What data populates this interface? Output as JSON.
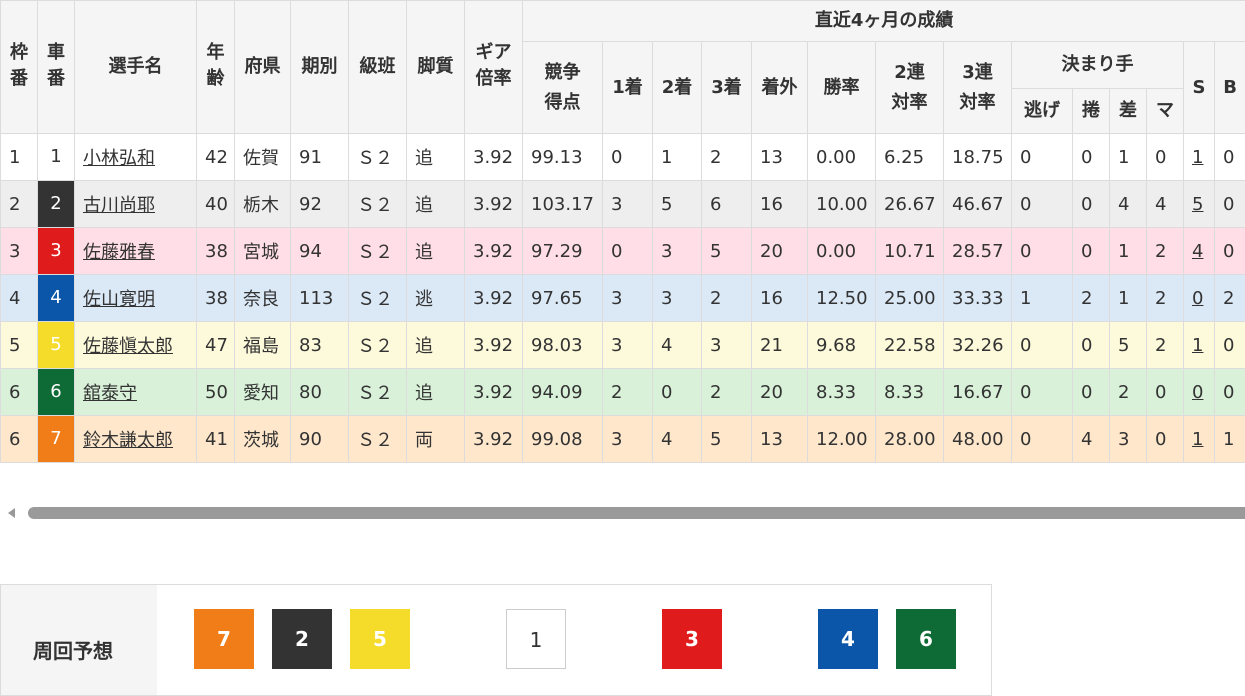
{
  "table": {
    "header": {
      "waku": "枠番",
      "car": "車番",
      "name": "選手名",
      "age": "年齢",
      "pref": "府県",
      "term": "期別",
      "class": "級班",
      "style": "脚質",
      "gear": "ギア倍率",
      "recent": "直近4ヶ月の成績",
      "points": "競争得点",
      "first": "1着",
      "second": "2着",
      "third": "3着",
      "out": "着外",
      "win_rate": "勝率",
      "rate2": "2連対率",
      "rate3": "3連対率",
      "kimarite": "決まり手",
      "nige": "逃げ",
      "makuri": "捲",
      "sashi": "差",
      "ma": "マ",
      "s": "S",
      "b": "B"
    },
    "rows": [
      {
        "waku": "1",
        "car": "1",
        "name": "小林弘和",
        "age": "42",
        "pref": "佐賀",
        "term": "91",
        "class": "Ｓ２",
        "style": "追",
        "gear": "3.92",
        "points": "99.13",
        "first": "0",
        "second": "1",
        "third": "2",
        "out": "13",
        "win_rate": "0.00",
        "rate2": "6.25",
        "rate3": "18.75",
        "nige": "0",
        "makuri": "0",
        "sashi": "1",
        "ma": "0",
        "s": "1",
        "b": "0"
      },
      {
        "waku": "2",
        "car": "2",
        "name": "古川尚耶",
        "age": "40",
        "pref": "栃木",
        "term": "92",
        "class": "Ｓ２",
        "style": "追",
        "gear": "3.92",
        "points": "103.17",
        "first": "3",
        "second": "5",
        "third": "6",
        "out": "16",
        "win_rate": "10.00",
        "rate2": "26.67",
        "rate3": "46.67",
        "nige": "0",
        "makuri": "0",
        "sashi": "4",
        "ma": "4",
        "s": "5",
        "b": "0"
      },
      {
        "waku": "3",
        "car": "3",
        "name": "佐藤雅春",
        "age": "38",
        "pref": "宮城",
        "term": "94",
        "class": "Ｓ２",
        "style": "追",
        "gear": "3.92",
        "points": "97.29",
        "first": "0",
        "second": "3",
        "third": "5",
        "out": "20",
        "win_rate": "0.00",
        "rate2": "10.71",
        "rate3": "28.57",
        "nige": "0",
        "makuri": "0",
        "sashi": "1",
        "ma": "2",
        "s": "4",
        "b": "0"
      },
      {
        "waku": "4",
        "car": "4",
        "name": "佐山寛明",
        "age": "38",
        "pref": "奈良",
        "term": "113",
        "class": "Ｓ２",
        "style": "逃",
        "gear": "3.92",
        "points": "97.65",
        "first": "3",
        "second": "3",
        "third": "2",
        "out": "16",
        "win_rate": "12.50",
        "rate2": "25.00",
        "rate3": "33.33",
        "nige": "1",
        "makuri": "2",
        "sashi": "1",
        "ma": "2",
        "s": "0",
        "b": "2"
      },
      {
        "waku": "5",
        "car": "5",
        "name": "佐藤愼太郎",
        "age": "47",
        "pref": "福島",
        "term": "83",
        "class": "Ｓ２",
        "style": "追",
        "gear": "3.92",
        "points": "98.03",
        "first": "3",
        "second": "4",
        "third": "3",
        "out": "21",
        "win_rate": "9.68",
        "rate2": "22.58",
        "rate3": "32.26",
        "nige": "0",
        "makuri": "0",
        "sashi": "5",
        "ma": "2",
        "s": "1",
        "b": "0"
      },
      {
        "waku": "6",
        "car": "6",
        "name": "舘泰守",
        "age": "50",
        "pref": "愛知",
        "term": "80",
        "class": "Ｓ２",
        "style": "追",
        "gear": "3.92",
        "points": "94.09",
        "first": "2",
        "second": "0",
        "third": "2",
        "out": "20",
        "win_rate": "8.33",
        "rate2": "8.33",
        "rate3": "16.67",
        "nige": "0",
        "makuri": "0",
        "sashi": "2",
        "ma": "0",
        "s": "0",
        "b": "0"
      },
      {
        "waku": "6",
        "car": "7",
        "name": "鈴木謙太郎",
        "age": "41",
        "pref": "茨城",
        "term": "90",
        "class": "Ｓ２",
        "style": "両",
        "gear": "3.92",
        "points": "99.08",
        "first": "3",
        "second": "4",
        "third": "5",
        "out": "13",
        "win_rate": "12.00",
        "rate2": "28.00",
        "rate3": "48.00",
        "nige": "0",
        "makuri": "4",
        "sashi": "3",
        "ma": "0",
        "s": "1",
        "b": "1"
      }
    ]
  },
  "forecast": {
    "label": "周回予想",
    "chips": [
      "7",
      "2",
      "5",
      "1",
      "3",
      "4",
      "6"
    ]
  },
  "colors": {
    "car1_bg": "#ffffff",
    "car2_bg": "#333333",
    "car3_bg": "#e01b1b",
    "car4_bg": "#0b56a8",
    "car5_bg": "#f5dc2a",
    "car6_bg": "#0e6b36",
    "car7_bg": "#f07d17"
  }
}
